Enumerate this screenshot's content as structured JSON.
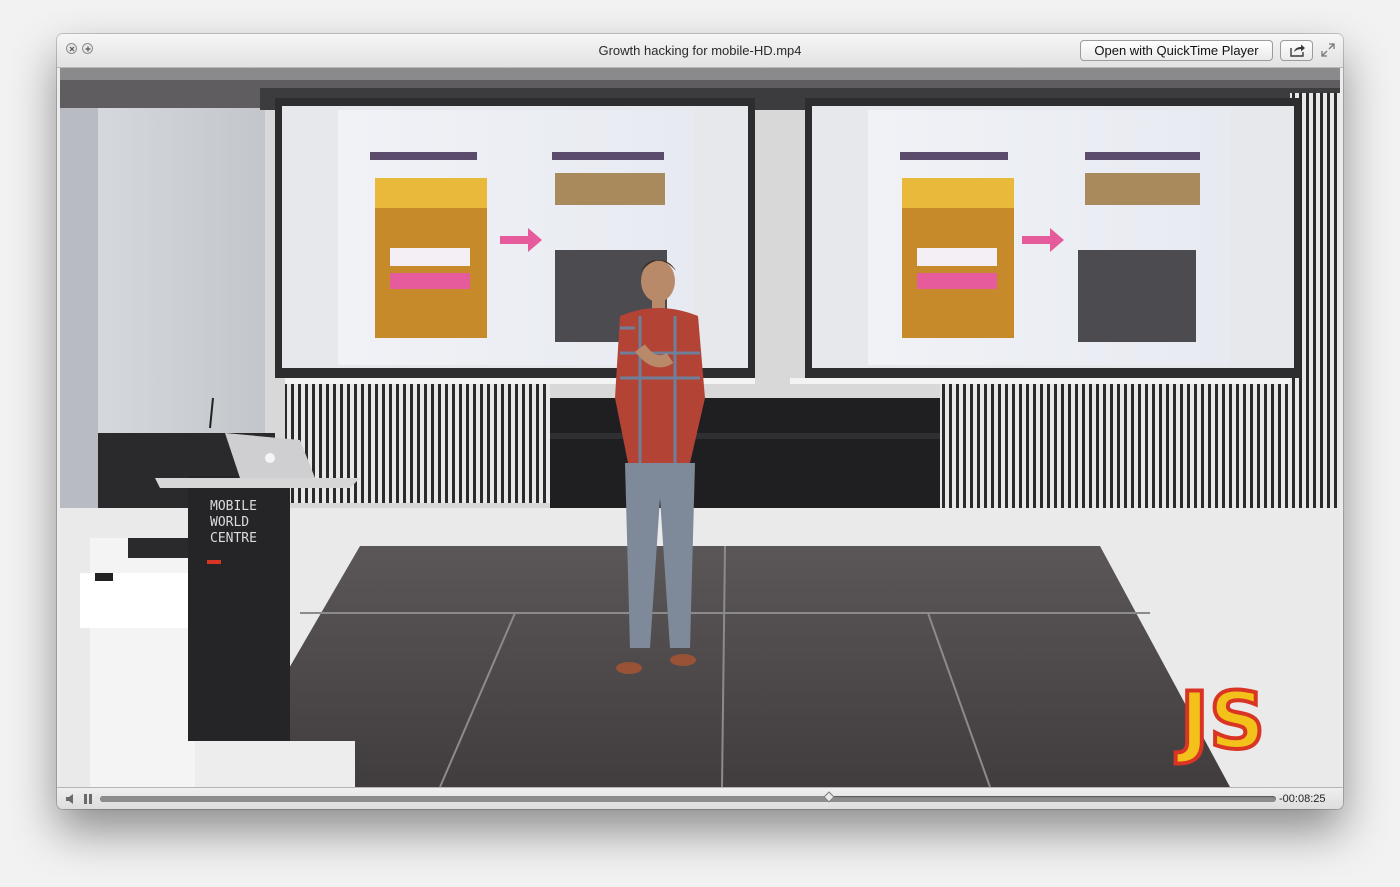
{
  "window": {
    "title": "Growth hacking for mobile-HD.mp4",
    "open_with_label": "Open with QuickTime Player"
  },
  "video": {
    "podium_text": [
      "MOBILE",
      "WORLD",
      "CENTRE"
    ],
    "logo_text": "JS"
  },
  "controls": {
    "time_remaining": "-00:08:25",
    "progress": 0.62
  },
  "colors": {
    "accent_pink": "#e55b9c",
    "logo_red": "#d93424",
    "logo_yellow": "#f2c21b"
  },
  "icons": {
    "close": "close-icon",
    "zoom": "zoom-icon",
    "share": "share-icon",
    "fullscreen": "fullscreen-icon",
    "volume": "volume-icon",
    "pause": "pause-icon"
  }
}
